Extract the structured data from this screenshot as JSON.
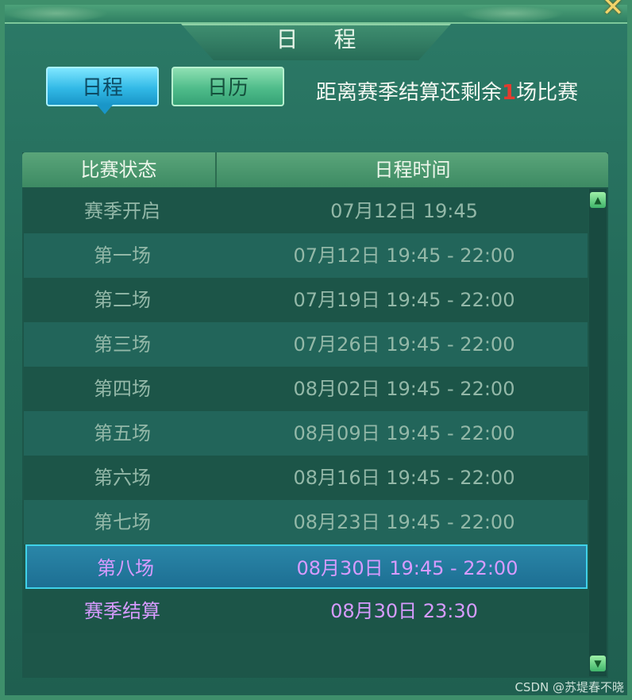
{
  "window": {
    "title": "日 程",
    "close_icon": "close-icon"
  },
  "tabs": [
    {
      "label": "日程",
      "active": true
    },
    {
      "label": "日历",
      "active": false
    }
  ],
  "remaining": {
    "prefix": "距离赛季结算还剩余",
    "count": "1",
    "suffix": "场比赛"
  },
  "table": {
    "headers": [
      "比赛状态",
      "日程时间"
    ],
    "rows": [
      {
        "status": "赛季开启",
        "time": "07月12日  19:45"
      },
      {
        "status": "第一场",
        "time": "07月12日  19:45  -  22:00"
      },
      {
        "status": "第二场",
        "time": "07月19日  19:45  -  22:00"
      },
      {
        "status": "第三场",
        "time": "07月26日  19:45  -  22:00"
      },
      {
        "status": "第四场",
        "time": "08月02日  19:45  -  22:00"
      },
      {
        "status": "第五场",
        "time": "08月09日  19:45  -  22:00"
      },
      {
        "status": "第六场",
        "time": "08月16日  19:45  -  22:00"
      },
      {
        "status": "第七场",
        "time": "08月23日  19:45  -  22:00"
      },
      {
        "status": "第八场",
        "time": "08月30日  19:45  -  22:00"
      },
      {
        "status": "赛季结算",
        "time": "08月30日  23:30"
      }
    ]
  },
  "watermark": "CSDN @苏堤春不晓",
  "colors": {
    "accent_active": "#32b9e6",
    "highlight_text": "#d79bff",
    "count_red": "#e33b2f"
  }
}
